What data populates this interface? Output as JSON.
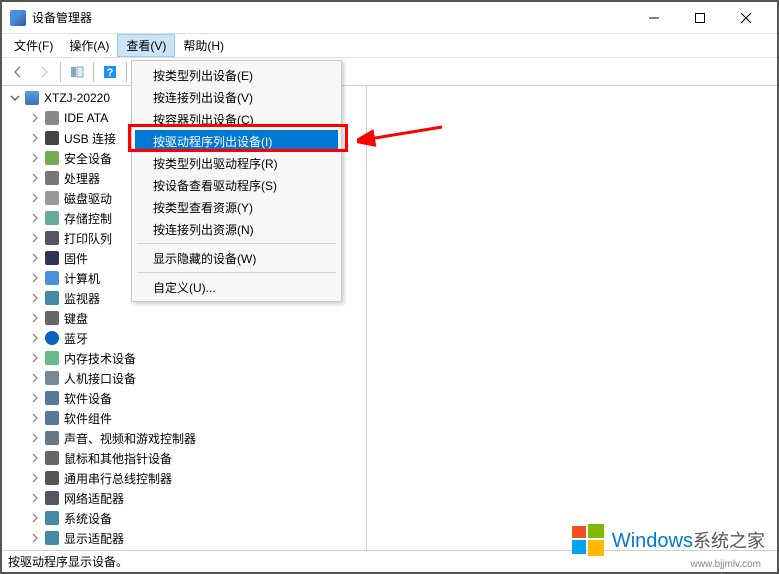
{
  "window": {
    "title": "设备管理器"
  },
  "menu": {
    "file": "文件(F)",
    "action": "操作(A)",
    "view": "查看(V)",
    "help": "帮助(H)"
  },
  "dropdown": {
    "items": [
      {
        "label": "按类型列出设备(E)",
        "highlighted": false
      },
      {
        "label": "按连接列出设备(V)",
        "highlighted": false
      },
      {
        "label": "按容器列出设备(C)",
        "highlighted": false
      },
      {
        "label": "按驱动程序列出设备(I)",
        "highlighted": true
      },
      {
        "label": "按类型列出驱动程序(R)",
        "highlighted": false
      },
      {
        "label": "按设备查看驱动程序(S)",
        "highlighted": false
      },
      {
        "label": "按类型查看资源(Y)",
        "highlighted": false
      },
      {
        "label": "按连接列出资源(N)",
        "highlighted": false
      }
    ],
    "showHidden": "显示隐藏的设备(W)",
    "customize": "自定义(U)..."
  },
  "tree": {
    "root": "XTZJ-20220",
    "children": [
      {
        "label": "IDE ATA",
        "icon": "ic-drive"
      },
      {
        "label": "USB 连接",
        "icon": "ic-usb"
      },
      {
        "label": "安全设备",
        "icon": "ic-shield"
      },
      {
        "label": "处理器",
        "icon": "ic-cpu"
      },
      {
        "label": "磁盘驱动",
        "icon": "ic-disk"
      },
      {
        "label": "存储控制",
        "icon": "ic-storage"
      },
      {
        "label": "打印队列",
        "icon": "ic-printer"
      },
      {
        "label": "固件",
        "icon": "ic-firmware"
      },
      {
        "label": "计算机",
        "icon": "ic-computer"
      },
      {
        "label": "监视器",
        "icon": "ic-monitor"
      },
      {
        "label": "键盘",
        "icon": "ic-keyboard"
      },
      {
        "label": "蓝牙",
        "icon": "ic-bt"
      },
      {
        "label": "内存技术设备",
        "icon": "ic-mem"
      },
      {
        "label": "人机接口设备",
        "icon": "ic-hid"
      },
      {
        "label": "软件设备",
        "icon": "ic-soft"
      },
      {
        "label": "软件组件",
        "icon": "ic-comp"
      },
      {
        "label": "声音、视频和游戏控制器",
        "icon": "ic-audio"
      },
      {
        "label": "鼠标和其他指针设备",
        "icon": "ic-mouse"
      },
      {
        "label": "通用串行总线控制器",
        "icon": "ic-usbctrl"
      },
      {
        "label": "网络适配器",
        "icon": "ic-net"
      },
      {
        "label": "系统设备",
        "icon": "ic-sys"
      },
      {
        "label": "显示适配器",
        "icon": "ic-display"
      }
    ]
  },
  "statusbar": {
    "text": "按驱动程序显示设备。"
  },
  "watermark": {
    "brand": "Windows",
    "sub": "系统之家",
    "url": "www.bjjmlv.com"
  }
}
